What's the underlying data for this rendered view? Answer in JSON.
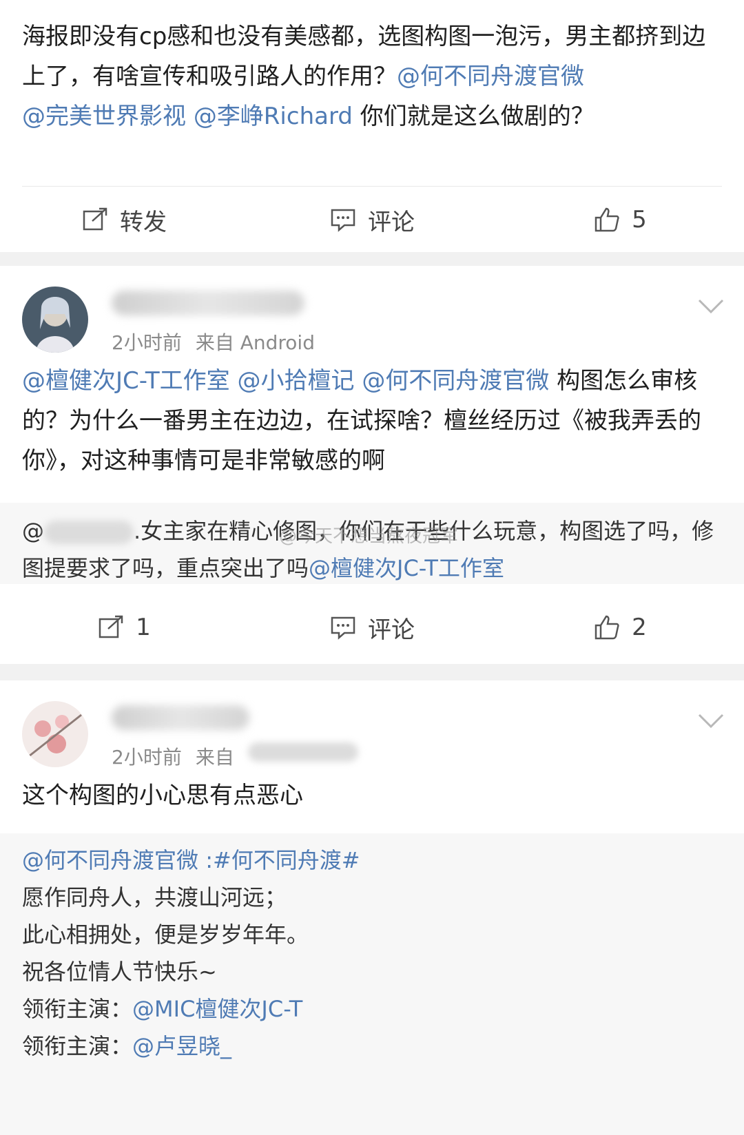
{
  "post1": {
    "text": "海报即没有cp感和也没有美感都，选图构图一泡污，男主都挤到边上了，有啥宣传和吸引路人的作用？",
    "mentions": [
      "@何不同舟渡官微",
      "@完美世界影视",
      "@李峥Richard"
    ],
    "tail": " 你们就是这么做剧的？",
    "actions": {
      "repost": "转发",
      "comment": "评论",
      "like_count": "5"
    }
  },
  "post2": {
    "time": "2小时前",
    "source": "来自 Android",
    "mentions": [
      "@檀健次JC-T工作室",
      "@小拾檀记",
      "@何不同舟渡官微"
    ],
    "text": " 构图怎么审核的？为什么一番男主在边边，在试探啥？檀丝经历过《被我弄丢的你》，对这种事情可是非常敏感的啊",
    "quote_prefix": "@",
    "quote_text": ".女主家在精心修图，你们在干些什么玩意，构图选了吗，修图提要求了吗，重点突出了吗",
    "quote_mention": "@檀健次JC-T工作室",
    "watermark": "@今天不想当熬夜冠军",
    "actions": {
      "repost_count": "1",
      "comment": "评论",
      "like_count": "2"
    }
  },
  "post3": {
    "time": "2小时前",
    "source": "来自",
    "text": "这个构图的小心思有点恶心",
    "quote_mention": "@何不同舟渡官微",
    "quote_tag": " :#何不同舟渡#",
    "lines": [
      "愿作同舟人，共渡山河远；",
      "此心相拥处，便是岁岁年年。",
      "祝各位情人节快乐~"
    ],
    "lead1_label": "领衔主演：",
    "lead1_mention": "@MIC檀健次JC-T",
    "lead2_label": "领衔主演：",
    "lead2_mention": "@卢昱晓_"
  }
}
